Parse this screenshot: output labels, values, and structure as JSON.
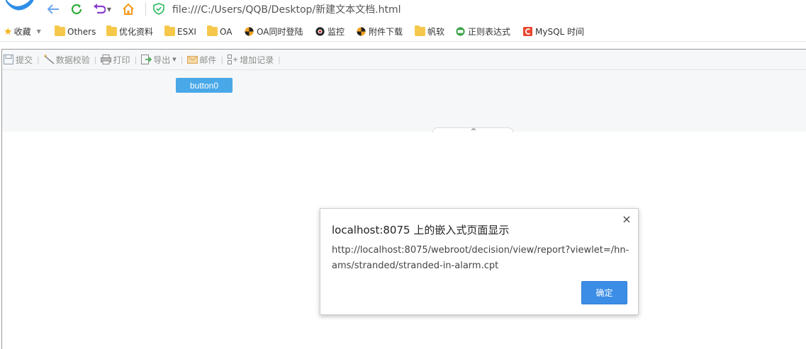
{
  "browser": {
    "url": "file:///C:/Users/QQB/Desktop/新建文本文档.html"
  },
  "bookmarks": {
    "favorites_label": "收藏",
    "items": [
      {
        "label": "Others",
        "icon": "folder-icon"
      },
      {
        "label": "优化资料",
        "icon": "folder-icon"
      },
      {
        "label": "ESXI",
        "icon": "folder-icon"
      },
      {
        "label": "OA",
        "icon": "folder-icon"
      },
      {
        "label": "OA同时登陆",
        "icon": "oa-site-icon"
      },
      {
        "label": "监控",
        "icon": "monitor-site-icon"
      },
      {
        "label": "附件下载",
        "icon": "oa-site-icon"
      },
      {
        "label": "帆软",
        "icon": "folder-icon"
      },
      {
        "label": "正则表达式",
        "icon": "regex-site-icon"
      },
      {
        "label": "MySQL 时间",
        "icon": "csdn-site-icon"
      }
    ]
  },
  "toolbar": {
    "submit": "提交",
    "validate": "数据校验",
    "print": "打印",
    "export": "导出",
    "mail": "邮件",
    "add_record": "增加记录"
  },
  "report": {
    "button0": "button0"
  },
  "dialog": {
    "title": "localhost:8075 上的嵌入式页面显示",
    "message": "http://localhost:8075/webroot/decision/view/report?viewlet=/hn-ams/stranded/stranded-in-alarm.cpt",
    "ok": "确定",
    "close_symbol": "×"
  },
  "colors": {
    "dialog_ok": "#3c8de6",
    "button0": "#49a8e8",
    "folder": "#f5c84c"
  }
}
